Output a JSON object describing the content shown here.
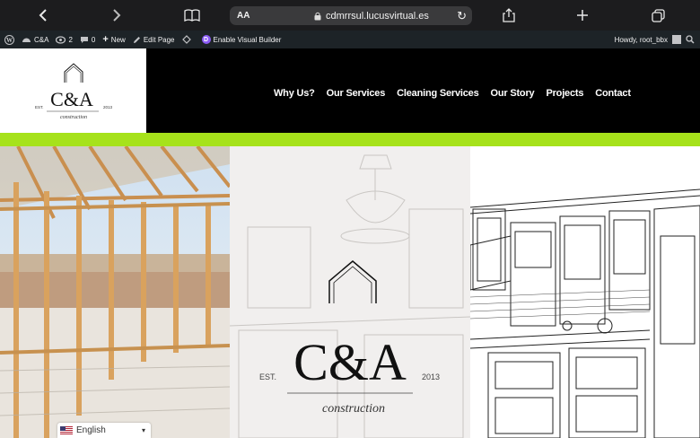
{
  "browser": {
    "back_glyph": "‹",
    "forward_glyph": "›",
    "text_size": "AA",
    "url": "cdmrrsul.lucusvirtual.es",
    "reload_glyph": "↻"
  },
  "admin_bar": {
    "site_name": "C&A",
    "revisions_count": "2",
    "comments_count": "0",
    "new_label": "New",
    "edit_label": "Edit Page",
    "visual_builder_label": "Enable Visual Builder",
    "divi_letter": "D",
    "howdy": "Howdy, root_bbx"
  },
  "logo": {
    "brand": "C&A",
    "est": "EST.",
    "year": "2013",
    "tagline": "construction"
  },
  "nav": {
    "items": [
      "Why Us?",
      "Our Services",
      "Cleaning Services",
      "Our Story",
      "Projects",
      "Contact"
    ]
  },
  "hero": {
    "brand": "C&A",
    "est": "EST.",
    "year": "2013",
    "tagline": "construction"
  },
  "language": {
    "selected": "English"
  },
  "colors": {
    "accent": "#a6e21b",
    "header_bg": "#000000",
    "admin_bg": "#1d2327",
    "browser_bg": "#1c1c1e"
  }
}
